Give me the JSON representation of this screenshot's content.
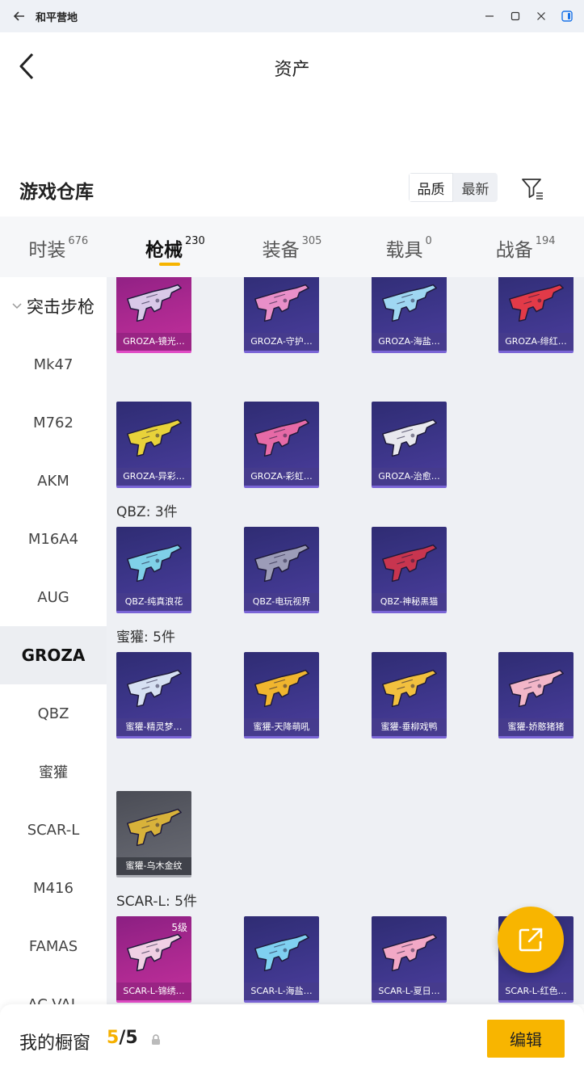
{
  "window": {
    "title": "和平营地",
    "back_icon": "arrow-left-icon",
    "controls": [
      "minimize-icon",
      "maximize-icon",
      "close-icon",
      "sidebar-toggle-icon"
    ],
    "accent": "#1a73e8"
  },
  "header": {
    "title": "资产",
    "back_icon": "chevron-left-icon"
  },
  "warehouse": {
    "title": "游戏仓库",
    "sort_options": [
      {
        "label": "品质",
        "selected": true
      },
      {
        "label": "最新",
        "selected": false
      }
    ],
    "filter_icon": "filter-icon"
  },
  "tabs": [
    {
      "label": "时装",
      "count": "676",
      "active": false
    },
    {
      "label": "枪械",
      "count": "230",
      "active": true
    },
    {
      "label": "装备",
      "count": "305",
      "active": false
    },
    {
      "label": "载具",
      "count": "0",
      "active": false
    },
    {
      "label": "战备",
      "count": "194",
      "active": false
    }
  ],
  "sidebar": {
    "group": "突击步枪",
    "items": [
      "Mk47",
      "M762",
      "AKM",
      "M16A4",
      "AUG",
      "GROZA",
      "QBZ",
      "蜜獾",
      "SCAR-L",
      "M416",
      "FAMAS",
      "AC-VAL"
    ],
    "active_item": "GROZA"
  },
  "sections": {
    "qbz_label": "QBZ: 3件",
    "honeybadger_label": "蜜獾: 5件",
    "scarl_label": "SCAR-L: 5件"
  },
  "cards": [
    {
      "name": "GROZA-镜光…",
      "rarity": "pink",
      "gun_color": "#d9c9e8"
    },
    {
      "name": "GROZA-守护…",
      "rarity": "purple",
      "gun_color": "#e88fc8"
    },
    {
      "name": "GROZA-海盐…",
      "rarity": "purple",
      "gun_color": "#9fd7f2"
    },
    {
      "name": "GROZA-绯红…",
      "rarity": "purple",
      "gun_color": "#e23a48"
    },
    {
      "name": "GROZA-异彩…",
      "rarity": "purple",
      "gun_color": "#e8d23a"
    },
    {
      "name": "GROZA-彩虹…",
      "rarity": "purple",
      "gun_color": "#e66aa6"
    },
    {
      "name": "GROZA-治愈…",
      "rarity": "purple",
      "gun_color": "#e8e8ee"
    },
    {
      "name": "QBZ-纯真浪花",
      "rarity": "purple",
      "gun_color": "#7fd0e8"
    },
    {
      "name": "QBZ-电玩视界",
      "rarity": "purple",
      "gun_color": "#9c9cb8"
    },
    {
      "name": "QBZ-神秘黑猫",
      "rarity": "purple",
      "gun_color": "#c8354f"
    },
    {
      "name": "蜜獾-精灵梦…",
      "rarity": "purple",
      "gun_color": "#d6e0f2"
    },
    {
      "name": "蜜獾-天降萌吼",
      "rarity": "purple",
      "gun_color": "#f0b52e"
    },
    {
      "name": "蜜獾-垂柳戏鸭",
      "rarity": "purple",
      "gun_color": "#f2c03e"
    },
    {
      "name": "蜜獾-娇憨猪猪",
      "rarity": "purple",
      "gun_color": "#f2b6c8"
    },
    {
      "name": "蜜獾-乌木金纹",
      "rarity": "gray",
      "gun_color": "#d8b23a"
    },
    {
      "name": "SCAR-L-锦绣…",
      "rarity": "pink",
      "gun_color": "#f0d0e4",
      "level": "5级"
    },
    {
      "name": "SCAR-L-海盐…",
      "rarity": "purple",
      "gun_color": "#7fd0f0"
    },
    {
      "name": "SCAR-L-夏日…",
      "rarity": "purple",
      "gun_color": "#f2a8c6"
    },
    {
      "name": "SCAR-L-红色…",
      "rarity": "purple",
      "gun_color": "#e84040"
    }
  ],
  "share_icon": "share-out-icon",
  "bottom": {
    "label": "我的橱窗",
    "current": "5",
    "separator": "/",
    "total": "5",
    "lock_icon": "lock-icon",
    "edit_label": "编辑",
    "accent": "#f8b500"
  }
}
